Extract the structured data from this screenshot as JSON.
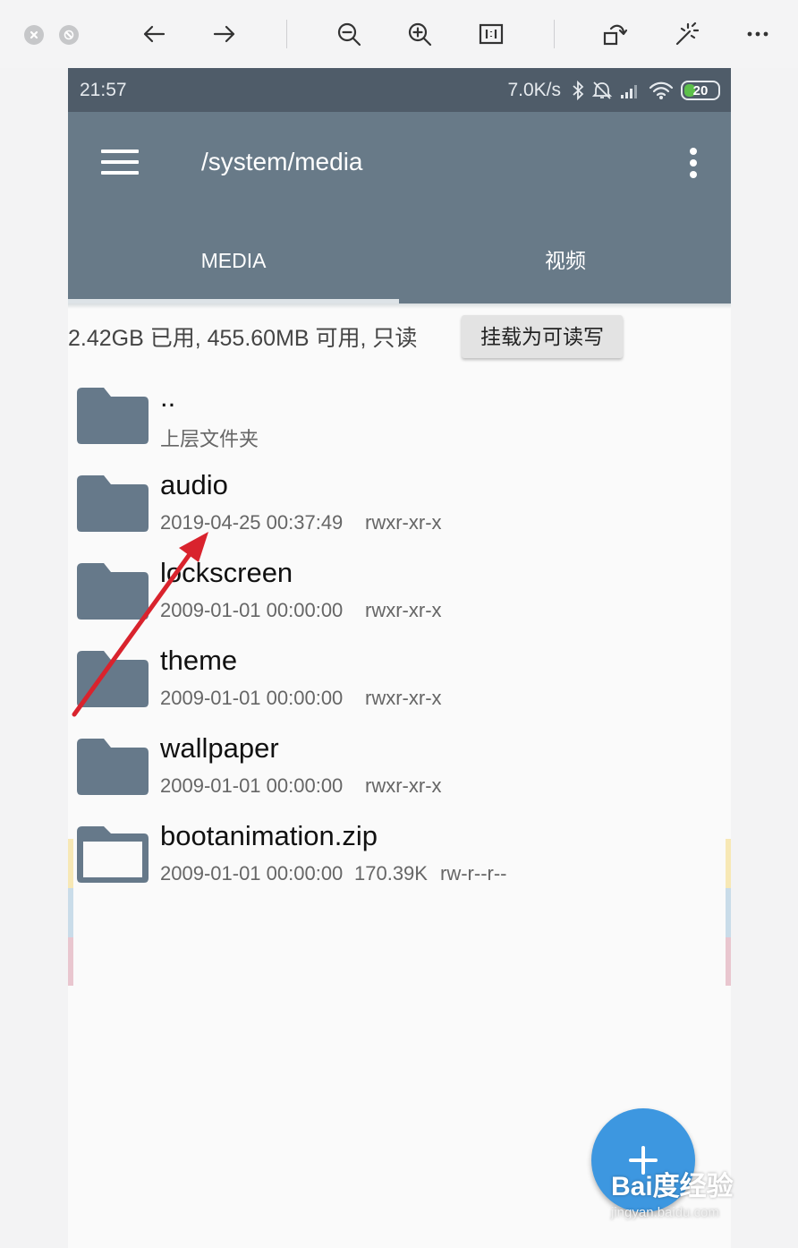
{
  "status_bar": {
    "time": "21:57",
    "net_speed": "7.0K/s",
    "battery": "20"
  },
  "app_bar": {
    "path": "/system/media",
    "tabs": [
      {
        "label": "MEDIA",
        "active": true
      },
      {
        "label": "视频",
        "active": false
      }
    ]
  },
  "storage": {
    "info": "2.42GB 已用, 455.60MB 可用, 只读",
    "mount_button": "挂载为可读写"
  },
  "files": [
    {
      "name": "..",
      "subtitle": "上层文件夹",
      "type": "folder"
    },
    {
      "name": "audio",
      "date": "2019-04-25 00:37:49",
      "perm": "rwxr-xr-x",
      "type": "folder"
    },
    {
      "name": "lockscreen",
      "date": "2009-01-01 00:00:00",
      "perm": "rwxr-xr-x",
      "type": "folder"
    },
    {
      "name": "theme",
      "date": "2009-01-01 00:00:00",
      "perm": "rwxr-xr-x",
      "type": "folder"
    },
    {
      "name": "wallpaper",
      "date": "2009-01-01 00:00:00",
      "perm": "rwxr-xr-x",
      "type": "folder"
    },
    {
      "name": "bootanimation.zip",
      "date": "2009-01-01 00:00:00",
      "size": "170.39K",
      "perm": "rw-r--r--",
      "type": "file"
    }
  ],
  "watermark": {
    "brand": "Bai度经验",
    "url": "jingyan.baidu.com"
  },
  "colors": {
    "status_bar": "#4f5c69",
    "app_bar": "#687a88",
    "folder_icon": "#66798a",
    "fab": "#3d97e0",
    "annotation_arrow": "#d9232d"
  },
  "icons": [
    "close-icon",
    "minimize-icon",
    "back-arrow-icon",
    "forward-arrow-icon",
    "zoom-out-icon",
    "zoom-in-icon",
    "actual-size-icon",
    "rotate-icon",
    "magic-wand-icon",
    "more-icon",
    "hamburger-menu-icon",
    "overflow-menu-icon",
    "folder-icon",
    "file-icon",
    "plus-icon"
  ]
}
